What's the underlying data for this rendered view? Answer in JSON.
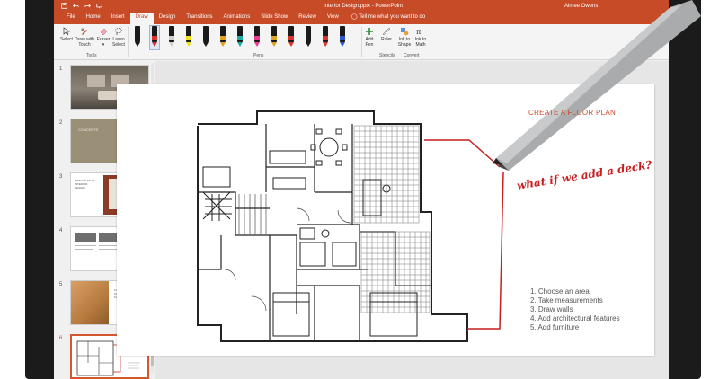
{
  "app": {
    "doc_title": "Interior Design.pptx - PowerPoint",
    "user": "Aimee Owens",
    "accent": "#c84b28",
    "pen_accent": "#c71f1f"
  },
  "quick_access": {
    "save_icon": "save-icon",
    "undo_icon": "undo-icon",
    "redo_icon": "redo-icon",
    "present_icon": "present-icon"
  },
  "tabs": [
    {
      "label": "File"
    },
    {
      "label": "Home"
    },
    {
      "label": "Insert"
    },
    {
      "label": "Draw"
    },
    {
      "label": "Design"
    },
    {
      "label": "Transitions"
    },
    {
      "label": "Animations"
    },
    {
      "label": "Slide Show"
    },
    {
      "label": "Review"
    },
    {
      "label": "View"
    }
  ],
  "active_tab": "Draw",
  "tell_me": "Tell me what you want to do",
  "ribbon": {
    "tools": {
      "select": "Select",
      "draw_with_touch_1": "Draw with",
      "draw_with_touch_2": "Touch",
      "eraser": "Eraser",
      "lasso_1": "Lasso",
      "lasso_2": "Select",
      "group": "Tools"
    },
    "pens": {
      "group": "Pens",
      "colors": [
        "#1a1a1a",
        "#d8322b",
        "#cfcfcf",
        "#f0e020",
        "#1a1a1a",
        "#e0a020",
        "#1eaaa0",
        "#ee3a8c",
        "#e0a020",
        "#d8322b",
        "#1a1a1a",
        "#d8322b",
        "#2b57c9"
      ]
    },
    "stencils": {
      "add_pen_1": "Add",
      "add_pen_2": "Pen",
      "ruler": "Ruler",
      "group": "Stencils"
    },
    "convert": {
      "ink_to_shape_1": "Ink to",
      "ink_to_shape_2": "Shape",
      "ink_to_math_1": "Ink to",
      "ink_to_math_2": "Math",
      "group": "Convert"
    }
  },
  "thumbnails": [
    {
      "number": "1",
      "caption": ""
    },
    {
      "number": "2",
      "caption": "CONCEPTS"
    },
    {
      "number": "3",
      "caption_1": "PRINCIPLES OF",
      "caption_2": "INTERIOR",
      "caption_3": "DESIGN"
    },
    {
      "number": "4",
      "caption": ""
    },
    {
      "number": "5",
      "caption_1": "FURNITURE",
      "caption_2": "AND",
      "caption_3": "FLOORPLAN"
    },
    {
      "number": "6",
      "caption": "what if we add a deck?"
    }
  ],
  "selected_slide": "6",
  "slide": {
    "title": "CREATE A FLOOR PLAN",
    "handwriting": "what if we add a deck?",
    "steps": [
      "1. Choose an area",
      "2. Take measurements",
      "3. Draw walls",
      "4. Add architectural features",
      "5. Add furniture"
    ]
  }
}
